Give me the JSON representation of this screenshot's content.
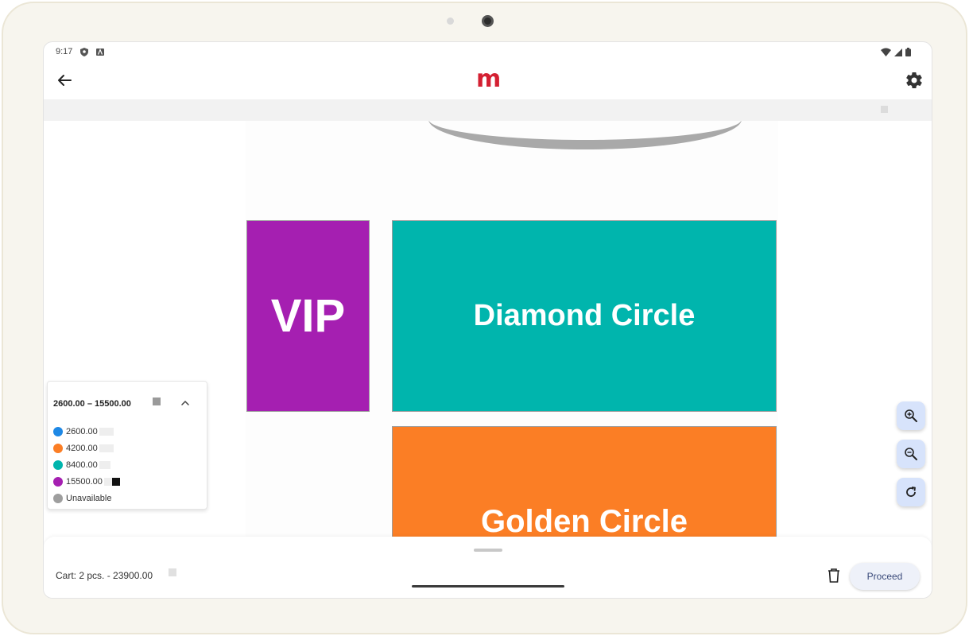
{
  "status": {
    "time": "9:17",
    "icons": [
      "shield-status-icon",
      "a-status-icon",
      "wifi-icon",
      "signal-icon",
      "battery-icon"
    ]
  },
  "appbar": {
    "logo": "m",
    "logo_color": "#d42032",
    "back_icon": "arrow-left-icon",
    "settings_icon": "gear-icon"
  },
  "seatmap": {
    "sections": [
      {
        "label": "VIP",
        "color": "#a51fb1"
      },
      {
        "label": "Diamond Circle",
        "color": "#00b5ad"
      },
      {
        "label": "Golden Circle",
        "color": "#fb7e25"
      }
    ],
    "stage_color": "#a9a9a9"
  },
  "legend": {
    "range": "2600.00 – 15500.00",
    "items": [
      {
        "label": "2600.00",
        "color": "#1e88e5"
      },
      {
        "label": "4200.00",
        "color": "#fb7e25"
      },
      {
        "label": "8400.00",
        "color": "#00b5ad"
      },
      {
        "label": "15500.00",
        "color": "#a51fb1"
      },
      {
        "label": "Unavailable",
        "color": "#9e9e9e"
      }
    ]
  },
  "zoom": {
    "zoom_in_icon": "zoom-in-icon",
    "zoom_out_icon": "zoom-out-icon",
    "reset_icon": "refresh-icon"
  },
  "cart": {
    "summary": "Cart: 2 pcs. - 23900.00",
    "proceed_label": "Proceed",
    "trash_icon": "trash-icon"
  }
}
